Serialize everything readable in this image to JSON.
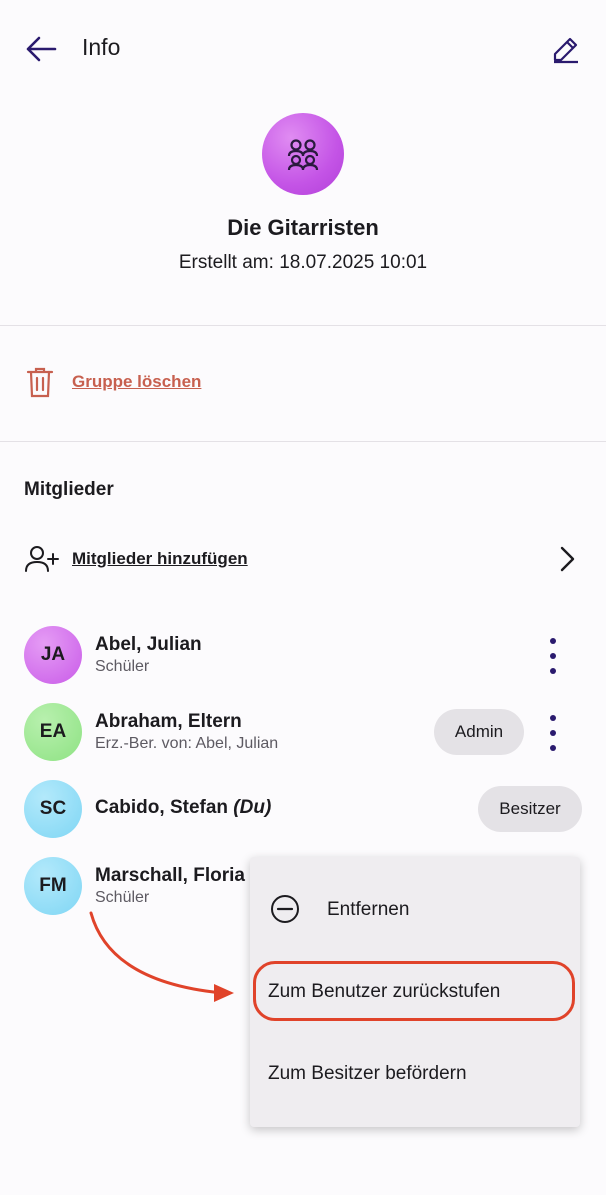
{
  "header": {
    "title": "Info",
    "back_icon": "arrow-left-icon",
    "edit_icon": "pencil-icon"
  },
  "group": {
    "name": "Die Gitarristen",
    "created_label": "Erstellt am:",
    "created_value": "18.07.2025 10:01",
    "avatar_icon": "group-icon"
  },
  "actions": {
    "delete_label": "Gruppe löschen",
    "delete_icon": "trash-icon"
  },
  "members": {
    "title": "Mitglieder",
    "add_label": "Mitglieder hinzufügen",
    "add_icon": "add-person-icon",
    "list": [
      {
        "initials": "JA",
        "name": "Abel, Julian",
        "suffix": "",
        "sub": "Schüler",
        "role": "",
        "color": "#c95be8"
      },
      {
        "initials": "EA",
        "name": "Abraham, Eltern",
        "suffix": "",
        "sub": "Erz.-Ber. von: Abel, Julian",
        "role": "Admin",
        "color": "#8ee283"
      },
      {
        "initials": "SC",
        "name": "Cabido, Stefan",
        "suffix": "(Du)",
        "sub": "",
        "role": "Besitzer",
        "color": "#7fd6f4"
      },
      {
        "initials": "FM",
        "name": "Marschall, Floria",
        "suffix": "",
        "sub": "Schüler",
        "role": "",
        "color": "#7fd6f4"
      }
    ]
  },
  "context_menu": {
    "items": [
      {
        "label": "Entfernen",
        "icon": "minus-circle-icon"
      },
      {
        "label": "Zum Benutzer zurückstufen"
      },
      {
        "label": "Zum Besitzer befördern"
      }
    ]
  },
  "colors": {
    "accent": "#2a1a6e",
    "danger": "#c7604f",
    "annotation": "#e0432a",
    "chip": "#e4e2e6"
  }
}
